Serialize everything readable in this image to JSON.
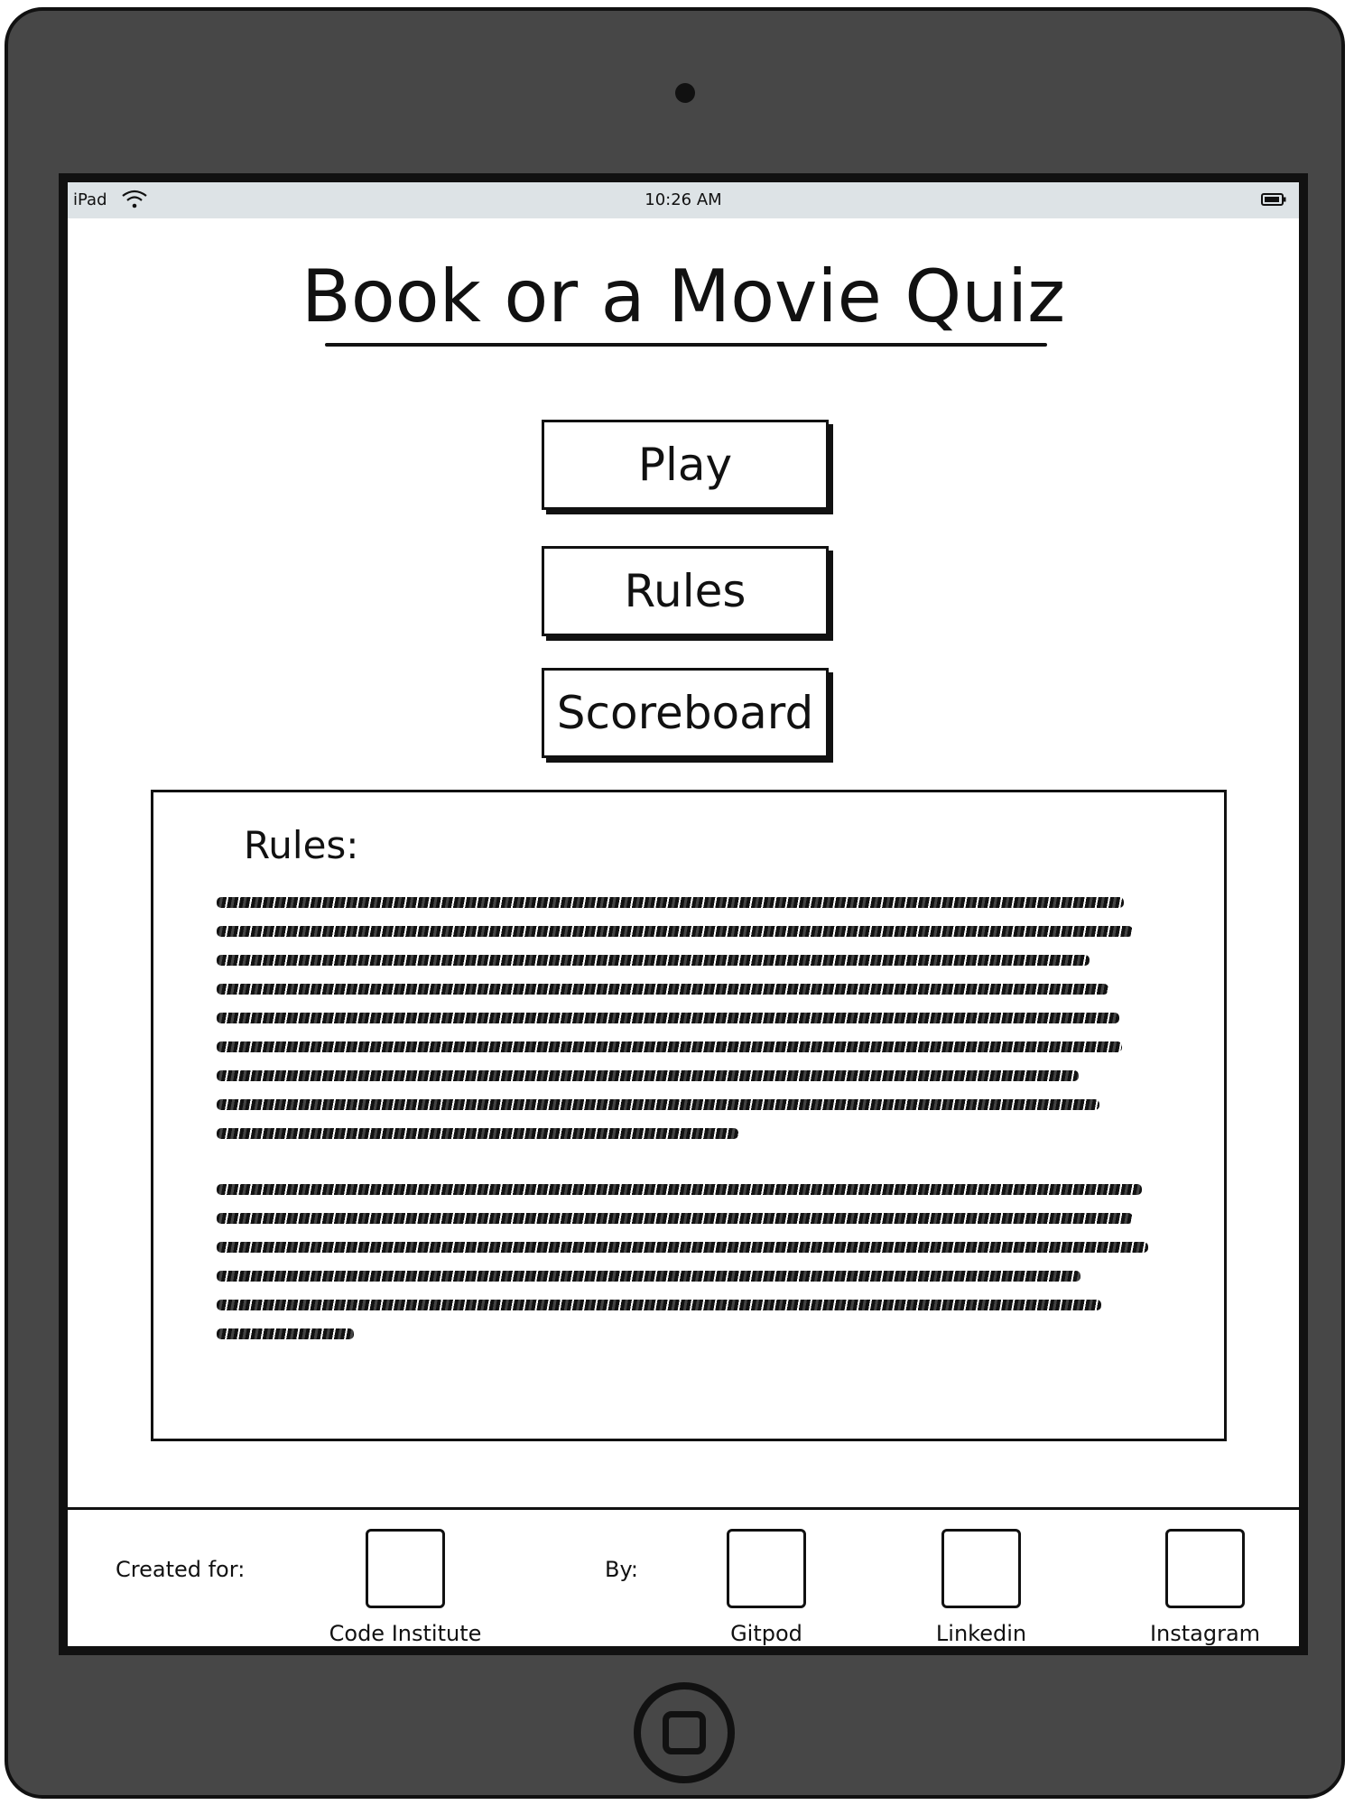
{
  "status_bar": {
    "device": "iPad",
    "time": "10:26 AM"
  },
  "title": "Book or a Movie Quiz",
  "menu": {
    "play": "Play",
    "rules": "Rules",
    "scoreboard": "Scoreboard"
  },
  "rules_panel": {
    "heading": "Rules:"
  },
  "footer": {
    "created_for_label": "Created for:",
    "by_label": "By:",
    "links": [
      {
        "label": "Code Institute"
      },
      {
        "label": "Gitpod"
      },
      {
        "label": "Linkedin"
      },
      {
        "label": "Instagram"
      }
    ]
  }
}
